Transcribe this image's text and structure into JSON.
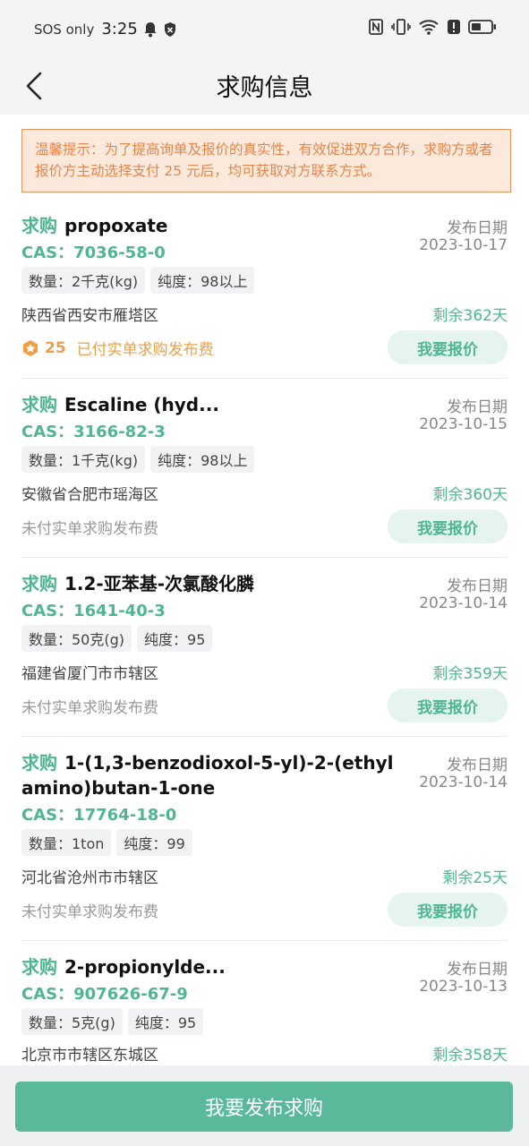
{
  "status_bar": {
    "carrier": "SOS only",
    "time": "3:25"
  },
  "header": {
    "title": "求购信息"
  },
  "notice": "温馨提示：为了提高询单及报价的真实性，有效促进双方合作，求购方或者报价方主动选择支付 25 元后，均可获取对方联系方式。",
  "tag_label": "求购",
  "date_label": "发布日期",
  "quote_label": "我要报价",
  "items": [
    {
      "name": "propoxate",
      "cas": "CAS：7036-58-0",
      "qty": "数量：2千克(kg)",
      "purity": "纯度：98以上",
      "location": "陕西省西安市雁塔区",
      "date": "2023-10-17",
      "remaining": "剩余362天",
      "fee_text": "已付实单求购发布费",
      "fee_amount": "25",
      "paid": true
    },
    {
      "name": "Escaline (hyd...",
      "cas": "CAS：3166-82-3",
      "qty": "数量：1千克(kg)",
      "purity": "纯度：98以上",
      "location": "安徽省合肥市瑶海区",
      "date": "2023-10-15",
      "remaining": "剩余360天",
      "fee_text": "未付实单求购发布费",
      "paid": false
    },
    {
      "name": "1.2-亚苯基-次氯酸化膦",
      "cas": "CAS：1641-40-3",
      "qty": "数量：50克(g)",
      "purity": "纯度：95",
      "location": "福建省厦门市市辖区",
      "date": "2023-10-14",
      "remaining": "剩余359天",
      "fee_text": "未付实单求购发布费",
      "paid": false
    },
    {
      "name": "1-(1,3-benzodioxol-5-yl)-2-(ethylamino)butan-1-one",
      "cas": "CAS：17764-18-0",
      "qty": "数量：1ton",
      "purity": "纯度：99",
      "location": "河北省沧州市市辖区",
      "date": "2023-10-14",
      "remaining": "剩余25天",
      "fee_text": "未付实单求购发布费",
      "paid": false
    },
    {
      "name": "2-propionylde...",
      "cas": "CAS：907626-67-9",
      "qty": "数量：5克(g)",
      "purity": "纯度：95",
      "location": "北京市市辖区东城区",
      "date": "2023-10-13",
      "remaining": "剩余358天",
      "paid": false
    }
  ],
  "publish_button": "我要发布求购"
}
